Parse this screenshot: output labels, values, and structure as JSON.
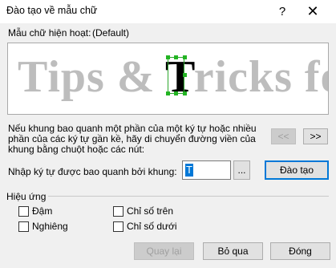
{
  "window": {
    "title": "Đào tạo về mẫu chữ",
    "help_glyph": "?",
    "close_glyph": "✕"
  },
  "sample": {
    "label": "Mẫu chữ hiện hoạt:",
    "value": "(Default)",
    "preview_before": "Tips & ",
    "preview_highlight": "T",
    "preview_after": "ricks fo"
  },
  "description": "Nếu khung bao quanh một phần của một ký tự hoặc nhiều phần của các ký tự gần kề, hãy di chuyển đường viền của khung bằng chuột hoặc các nút:",
  "nav": {
    "prev_label": "<<",
    "next_label": ">>"
  },
  "char_input": {
    "label": "Nhập ký tự được bao quanh bởi khung:",
    "value": "T",
    "browse_label": "...",
    "train_label": "Đào tạo"
  },
  "effects": {
    "heading": "Hiệu ứng",
    "bold": "Đậm",
    "italic": "Nghiêng",
    "superscript": "Chỉ số trên",
    "subscript": "Chỉ số dưới"
  },
  "footer": {
    "reset_label": "Quay lại",
    "skip_label": "Bỏ qua",
    "close_label": "Đóng"
  },
  "colors": {
    "accent": "#0078d7",
    "frame_handle": "#23b423",
    "preview_text": "#bdbdbd"
  }
}
